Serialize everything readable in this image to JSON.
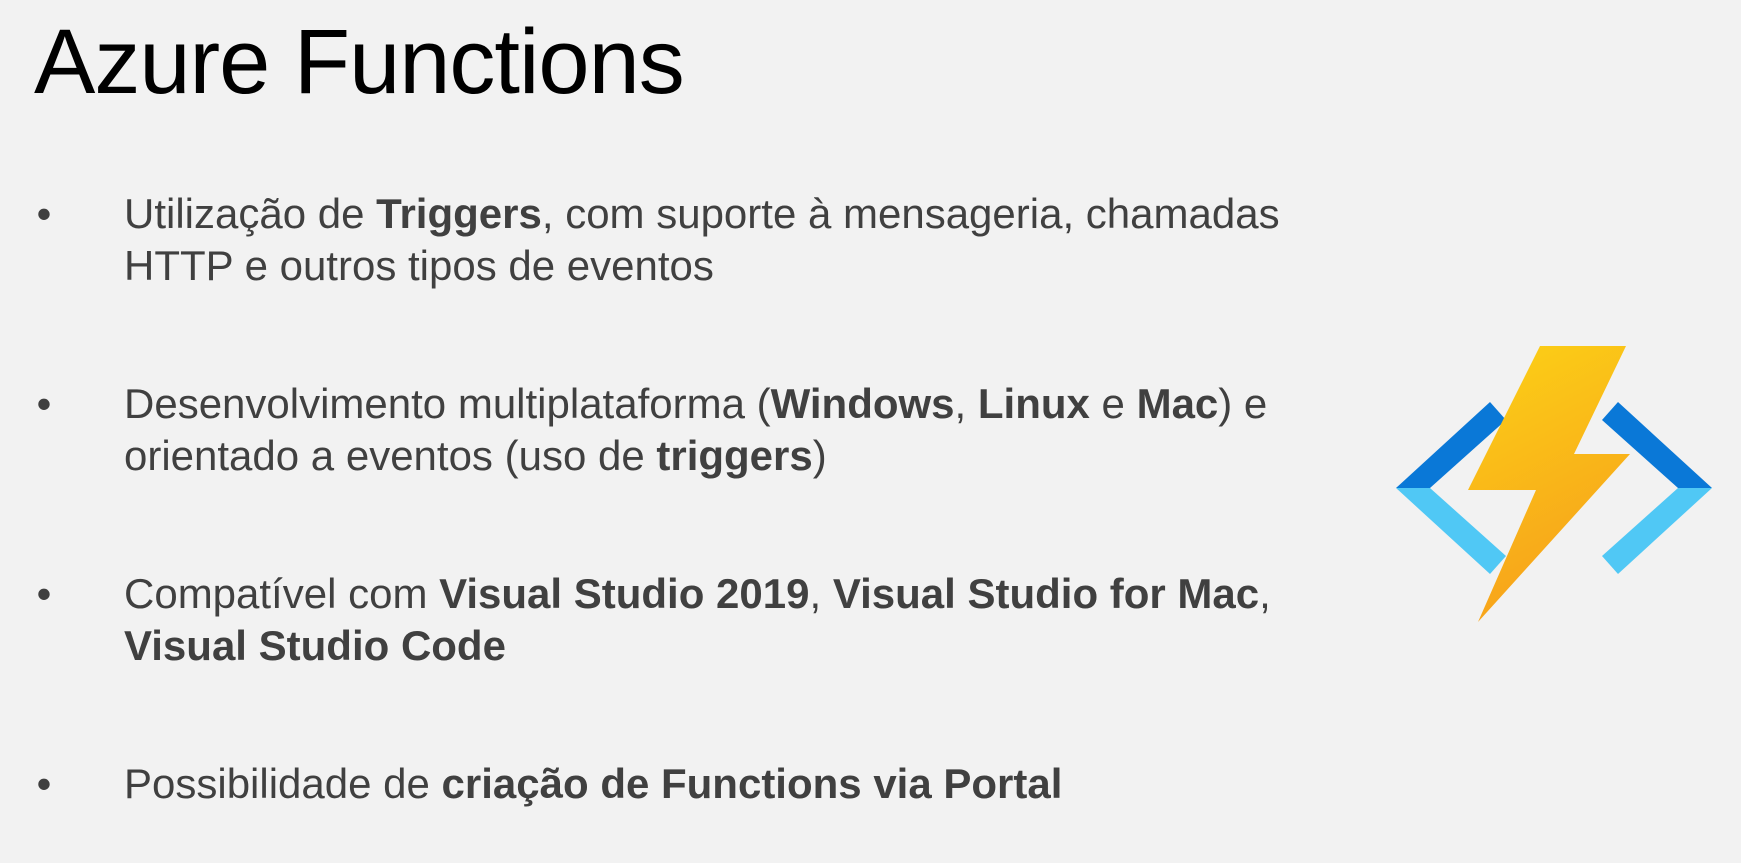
{
  "slide": {
    "title": "Azure Functions",
    "bullets": [
      {
        "segments": [
          {
            "text": "Utilização de ",
            "bold": false
          },
          {
            "text": "Triggers",
            "bold": true
          },
          {
            "text": ", com suporte à mensageria, chamadas HTTP e outros tipos de eventos",
            "bold": false
          }
        ]
      },
      {
        "segments": [
          {
            "text": "Desenvolvimento multiplataforma (",
            "bold": false
          },
          {
            "text": "Windows",
            "bold": true
          },
          {
            "text": ", ",
            "bold": false
          },
          {
            "text": "Linux",
            "bold": true
          },
          {
            "text": " e ",
            "bold": false
          },
          {
            "text": "Mac",
            "bold": true
          },
          {
            "text": ") e orientado a eventos (uso de ",
            "bold": false
          },
          {
            "text": "triggers",
            "bold": true
          },
          {
            "text": ")",
            "bold": false
          }
        ]
      },
      {
        "segments": [
          {
            "text": "Compatível com ",
            "bold": false
          },
          {
            "text": "Visual Studio 2019",
            "bold": true
          },
          {
            "text": ", ",
            "bold": false
          },
          {
            "text": "Visual Studio for Mac",
            "bold": true
          },
          {
            "text": ", ",
            "bold": false
          },
          {
            "text": "Visual Studio Code",
            "bold": true
          }
        ]
      },
      {
        "segments": [
          {
            "text": "Possibilidade de ",
            "bold": false
          },
          {
            "text": "criação de Functions via Portal",
            "bold": true
          }
        ]
      }
    ],
    "bullet_glyph": "•"
  },
  "logo": {
    "icon": "azure-functions-logo-icon",
    "colors": {
      "bolt_top": "#fcd116",
      "bolt_bottom": "#f7a21b",
      "bracket_dark": "#0a78d7",
      "bracket_light": "#50c8f5"
    }
  }
}
